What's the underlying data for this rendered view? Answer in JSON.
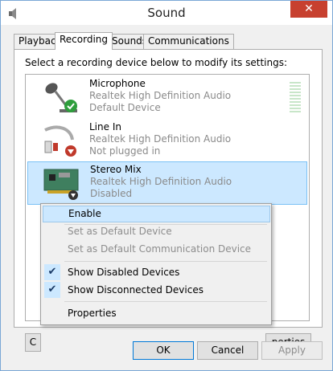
{
  "window": {
    "title": "Sound",
    "close_glyph": "✕"
  },
  "tabs": [
    {
      "label": "Playback"
    },
    {
      "label": "Recording",
      "active": true
    },
    {
      "label": "Sounds"
    },
    {
      "label": "Communications"
    }
  ],
  "instruction": "Select a recording device below to modify its settings:",
  "devices": [
    {
      "name": "Microphone",
      "driver": "Realtek High Definition Audio",
      "status": "Default Device",
      "icon": "microphone-icon",
      "badge": "green-check"
    },
    {
      "name": "Line In",
      "driver": "Realtek High Definition Audio",
      "status": "Not plugged in",
      "icon": "line-in-cable-icon",
      "badge": "red-down-arrow"
    },
    {
      "name": "Stereo Mix",
      "driver": "Realtek High Definition Audio",
      "status": "Disabled",
      "icon": "sound-card-icon",
      "badge": "black-down-arrow",
      "selected": true
    }
  ],
  "context_menu": {
    "items": [
      {
        "label": "Enable",
        "state": "hover"
      },
      {
        "label": "Set as Default Device",
        "state": "disabled"
      },
      {
        "label": "Set as Default Communication Device",
        "state": "disabled"
      },
      {
        "label": "Show Disabled Devices",
        "checked": true
      },
      {
        "label": "Show Disconnected Devices",
        "checked": true
      },
      {
        "label": "Properties"
      }
    ],
    "check_glyph": "✔"
  },
  "panel_buttons": {
    "configure_partial": "C",
    "properties_partial": "perties"
  },
  "bottom_buttons": {
    "ok": "OK",
    "cancel": "Cancel",
    "apply": "Apply"
  },
  "colors": {
    "selection": "#cce8ff",
    "close": "#c7402f",
    "accent": "#0078d7"
  }
}
